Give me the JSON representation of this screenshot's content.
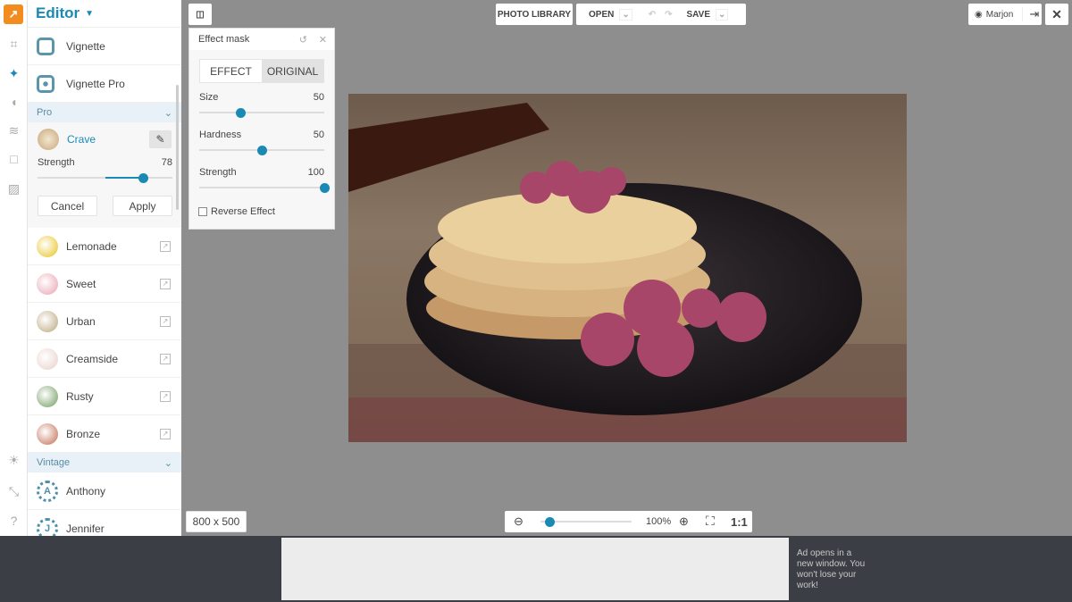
{
  "sidebar_rail": {
    "icons": [
      "logo-icon",
      "crop-icon",
      "magic-wand-icon",
      "hair-icon",
      "layers-icon",
      "frame-icon",
      "texture-icon",
      "lightbulb-icon",
      "collapse-icon",
      "help-icon"
    ],
    "help": "?",
    "accent": "#1a8ab5"
  },
  "panel": {
    "title": "Editor",
    "top_items": [
      {
        "label": "Vignette"
      },
      {
        "label": "Vignette Pro"
      }
    ],
    "sections": {
      "pro": "Pro",
      "vintage": "Vintage"
    },
    "active": {
      "label": "Crave",
      "strength_label": "Strength",
      "strength": 78,
      "strength_max": 100,
      "cancel": "Cancel",
      "apply": "Apply"
    },
    "pro_items": [
      {
        "label": "Lemonade",
        "color": "#e8c21a"
      },
      {
        "label": "Sweet",
        "color": "#e8a0b0"
      },
      {
        "label": "Urban",
        "color": "#b9a47a"
      },
      {
        "label": "Creamside",
        "color": "#e8cfc8"
      },
      {
        "label": "Rusty",
        "color": "#6e9a5c"
      },
      {
        "label": "Bronze",
        "color": "#c06a50"
      }
    ],
    "vintage_items": [
      {
        "label": "Anthony",
        "letter": "A"
      },
      {
        "label": "Jennifer",
        "letter": "J"
      }
    ]
  },
  "toolbar": {
    "photo_library": "PHOTO LIBRARY",
    "open": "OPEN",
    "save": "SAVE",
    "user": "Marjon"
  },
  "effect_mask": {
    "title": "Effect mask",
    "tabs": [
      "EFFECT",
      "ORIGINAL"
    ],
    "active_tab": "ORIGINAL",
    "sliders": [
      {
        "label": "Size",
        "value": 50,
        "fraction": 0.33
      },
      {
        "label": "Hardness",
        "value": 50,
        "fraction": 0.5
      },
      {
        "label": "Strength",
        "value": 100,
        "fraction": 1
      }
    ],
    "reverse": "Reverse Effect",
    "reverse_checked": false
  },
  "image_size": "800 x 500",
  "zoom": {
    "percent": "100%",
    "fraction": 0.1,
    "one_to_one": "1:1"
  },
  "ad": {
    "note": "Ad opens in a new window. You won't lose your work!"
  }
}
